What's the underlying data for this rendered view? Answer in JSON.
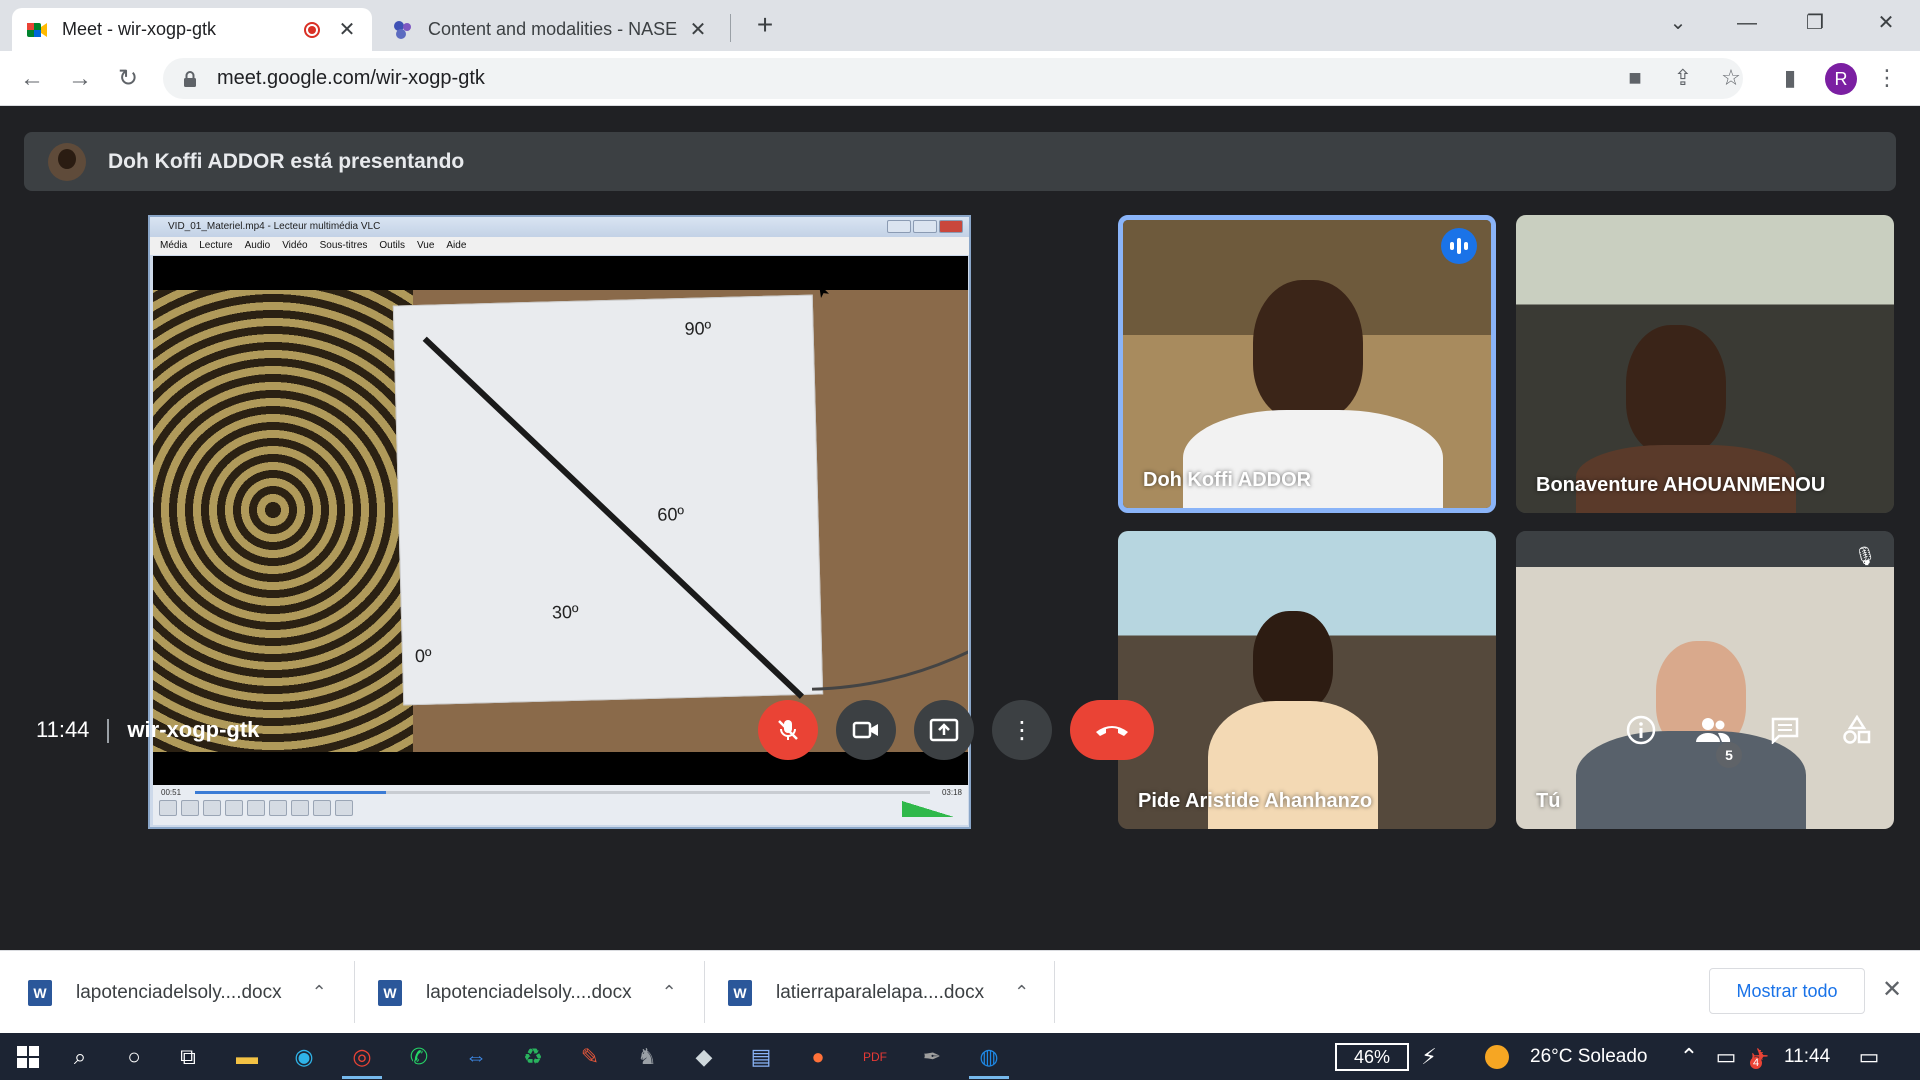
{
  "browser": {
    "tabs": [
      {
        "title": "Meet - wir-xogp-gtk",
        "active": true,
        "recording": true
      },
      {
        "title": "Content and modalities - NASE",
        "active": false
      }
    ],
    "url": "meet.google.com/wir-xogp-gtk",
    "profile_initial": "R"
  },
  "meet": {
    "presenting_text": "Doh Koffi ADDOR está presentando",
    "clock": "11:44",
    "meeting_code": "wir-xogp-gtk",
    "participants_count": "5",
    "participants": [
      {
        "name": "Doh Koffi ADDOR",
        "speaking": true,
        "muted": false
      },
      {
        "name": "Bonaventure AHOUANMENOU",
        "speaking": false,
        "muted": false
      },
      {
        "name": "Pide Aristide Ahanhanzo",
        "speaking": false,
        "muted": false
      },
      {
        "name": "Tú",
        "speaking": false,
        "muted": true
      }
    ],
    "shared_window": {
      "title": "VID_01_Materiel.mp4 - Lecteur multimédia VLC",
      "menu": [
        "Média",
        "Lecture",
        "Audio",
        "Vidéo",
        "Sous-titres",
        "Outils",
        "Vue",
        "Aide"
      ],
      "elapsed": "00:51",
      "duration": "03:18",
      "progress": 0.26,
      "volume": "100%",
      "protractor_labels": [
        "0º",
        "30º",
        "60º",
        "90º"
      ]
    }
  },
  "downloads": {
    "items": [
      "lapotenciadelsoly....docx",
      "lapotenciadelsoly....docx",
      "latierraparalelapa....docx"
    ],
    "show_all": "Mostrar todo"
  },
  "taskbar": {
    "battery": "46%",
    "weather": "26°C  Soleado",
    "time": "11:44",
    "notification_count": "4"
  }
}
